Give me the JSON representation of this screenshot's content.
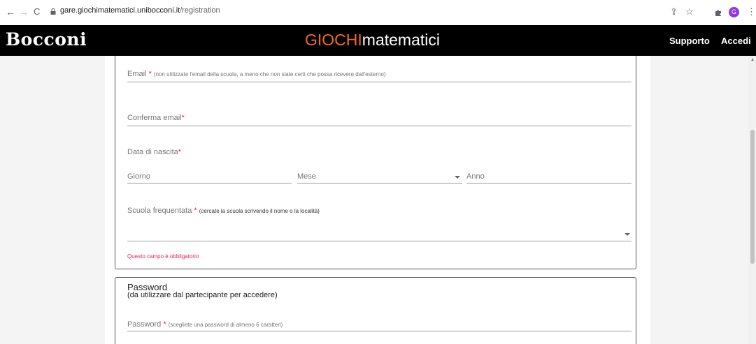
{
  "browser": {
    "url_host": "gare.giochimatematici.unibocconi.it",
    "url_path": "/registration",
    "back_icon": "arrow-left",
    "forward_icon": "arrow-right",
    "reload_icon": "reload",
    "share_icon": "share",
    "star_icon": "star",
    "extensions_icon": "puzzle",
    "avatar_letter": "G",
    "menu_icon": "kebab"
  },
  "header": {
    "logo": "Bocconi",
    "title_highlight": "GIOCHI",
    "title_rest": "matematici",
    "links": [
      "Supporto",
      "Accedi"
    ],
    "highlight_color": "#f26a1b"
  },
  "form": {
    "email": {
      "label": "Email",
      "required_mark": "*",
      "hint": "(non utilizzate l'email della scuola, a meno che non siate certi che possa ricevere dall'esterno)"
    },
    "confirm_email": {
      "label": "Conferma email",
      "required_mark": "*"
    },
    "birth_date": {
      "label": "Data di nascita",
      "required_mark": "*",
      "day_placeholder": "Giorno",
      "month_placeholder": "Mese",
      "year_placeholder": "Anno"
    },
    "school": {
      "label": "Scuola frequentata",
      "required_mark": "*",
      "hint": "(cercate la scuola scrivendo il nome o la località)",
      "error": "Questo campo è obbligatorio"
    },
    "password_section": {
      "title": "Password",
      "subtitle": "(da utilizzare dal partecipante per accedere)",
      "field_label": "Password",
      "required_mark": "*",
      "hint": "(scegliete una password di almeno 6 caratteri)"
    }
  },
  "colors": {
    "required": "#e91e63",
    "header_bg": "#000000"
  }
}
